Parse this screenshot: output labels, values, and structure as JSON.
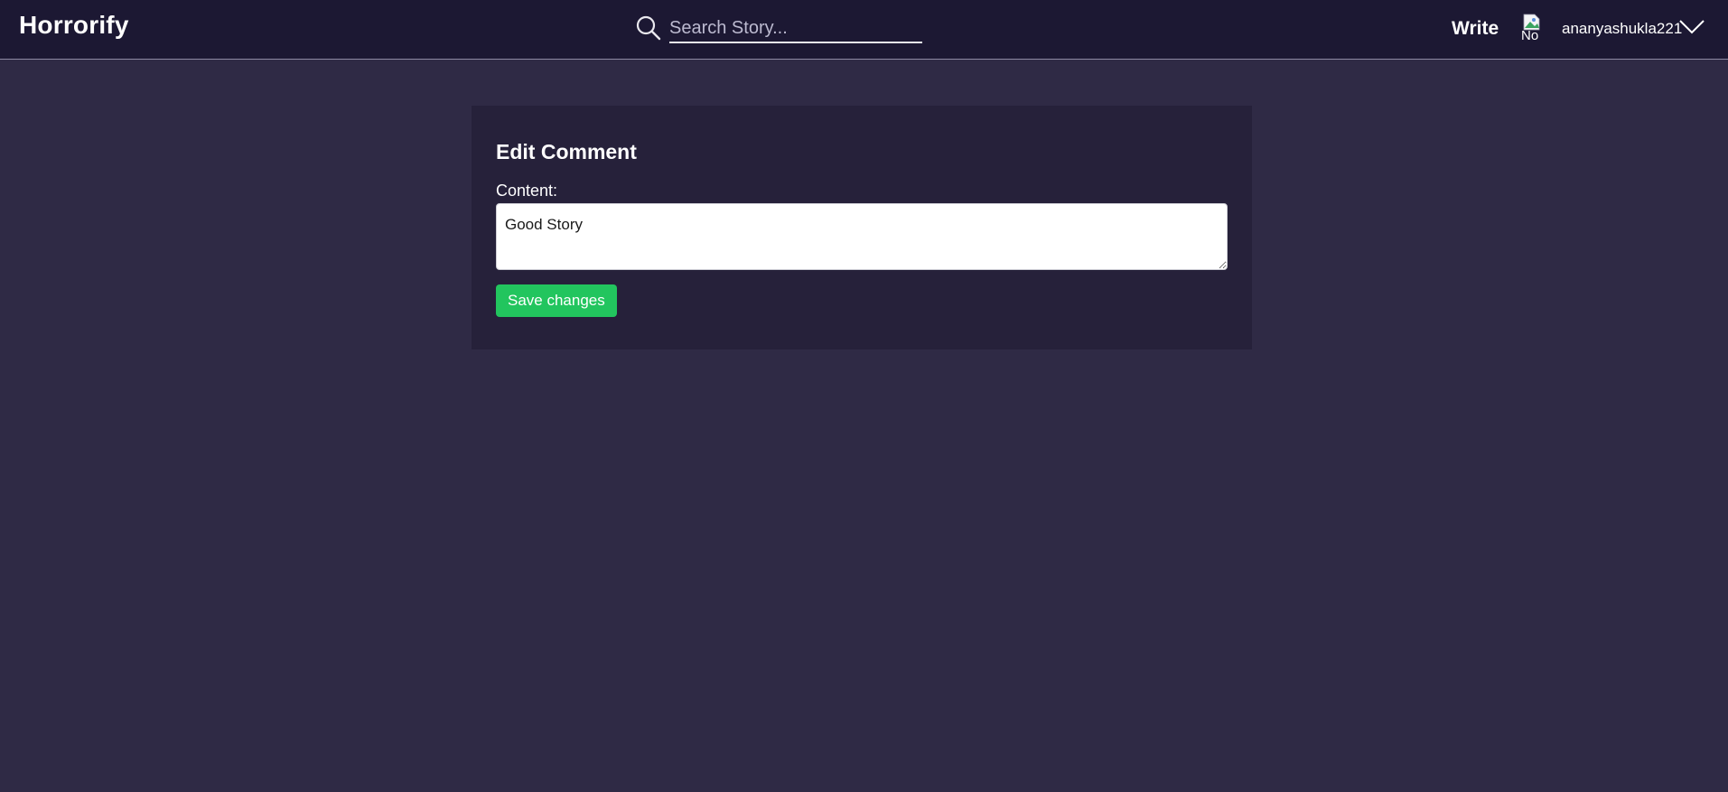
{
  "navbar": {
    "brand": "Horrorify",
    "search": {
      "placeholder": "Search Story...",
      "value": "",
      "icon": "search-icon"
    },
    "write_label": "Write",
    "avatar_alt": "No",
    "username": "ananyashukla221",
    "dropdown_icon": "chevron-down-icon"
  },
  "edit_form": {
    "title": "Edit Comment",
    "content_label": "Content:",
    "content_value": "Good Story",
    "save_label": "Save changes"
  },
  "colors": {
    "page_background": "#2f2a45",
    "navbar_background": "#1c1833",
    "card_background": "#26213a",
    "accent_green": "#22c55e"
  }
}
